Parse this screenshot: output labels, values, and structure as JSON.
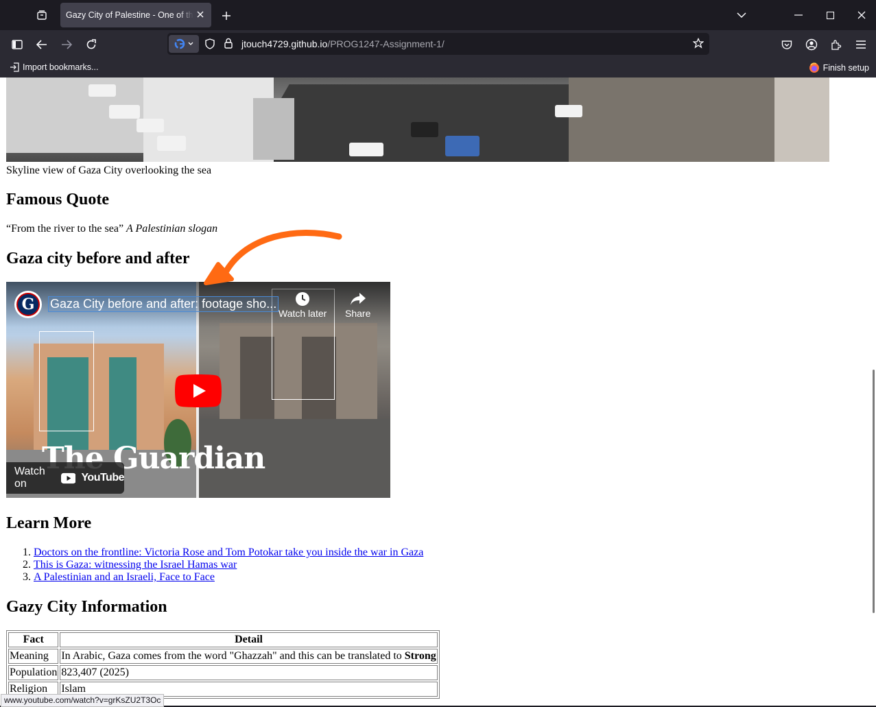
{
  "browser": {
    "tab_title": "Gazy City of Palestine - One of the cities",
    "url_domain": "jtouch4729.github.io",
    "url_path": "/PROG1247-Assignment-1/",
    "bookmarks": {
      "import_label": "Import bookmarks...",
      "finish_label": "Finish setup"
    },
    "status_url": "www.youtube.com/watch?v=grKsZU2T3Oc"
  },
  "page": {
    "image_caption": "Skyline view of Gaza City overlooking the sea",
    "quote_heading": "Famous Quote",
    "quote_text": "“From the river to the sea”",
    "quote_source": "A Palestinian slogan",
    "video_heading": "Gaza city before and after",
    "video": {
      "title": "Gaza City before and after: footage sho...",
      "logo_letter": "G",
      "watch_later": "Watch later",
      "share": "Share",
      "watch_on": "Watch on",
      "youtube": "YouTube",
      "overlay_text": "The Guardian"
    },
    "learn_heading": "Learn More",
    "links": [
      "Doctors on the frontline: Victoria Rose and Tom Potokar take you inside the war in Gaza",
      "This is Gaza: witnessing the Israel Hamas war",
      "A Palestinian and an Israeli, Face to Face"
    ],
    "info_heading": "Gazy City Information",
    "table": {
      "headers": [
        "Fact",
        "Detail"
      ],
      "rows": [
        {
          "fact": "Meaning",
          "detail": "In Arabic, Gaza comes from the word \"Ghazzah\" and this can be translated to ",
          "detail_bold": "Strong"
        },
        {
          "fact": "Population",
          "detail": "823,407 (2025)"
        },
        {
          "fact": "Religion",
          "detail": "Islam"
        }
      ]
    }
  }
}
